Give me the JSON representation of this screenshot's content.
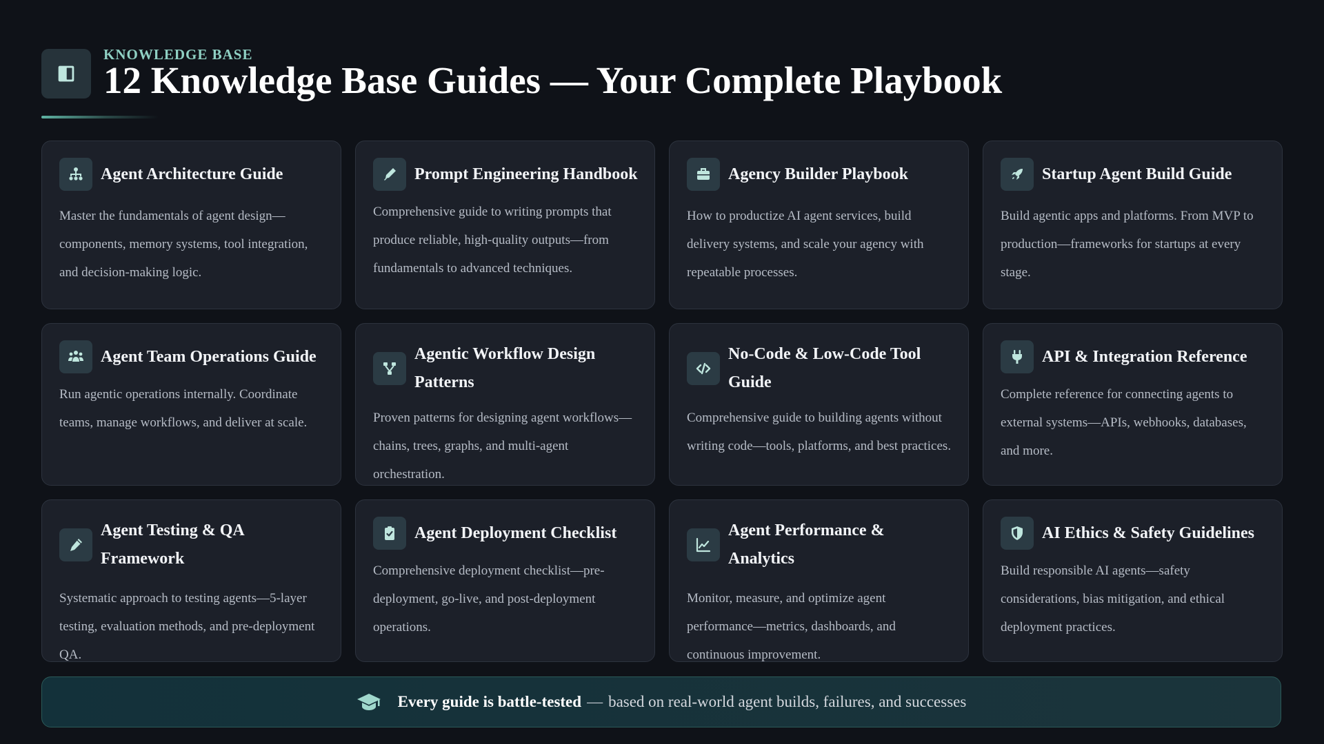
{
  "header": {
    "kicker": "KNOWLEDGE BASE",
    "title": "12 Knowledge Base Guides — Your Complete Playbook",
    "icon": "book-open-icon"
  },
  "cards": [
    {
      "icon": "hierarchy-icon",
      "title": "Agent Architecture Guide",
      "description": "Master the fundamentals of agent design—components, memory systems, tool integration, and decision-making logic."
    },
    {
      "icon": "pen-icon",
      "title": "Prompt Engineering Handbook",
      "description": "Comprehensive guide to writing prompts that produce reliable, high-quality outputs—from fundamentals to advanced techniques."
    },
    {
      "icon": "briefcase-icon",
      "title": "Agency Builder Playbook",
      "description": "How to productize AI agent services, build delivery systems, and scale your agency with repeatable processes."
    },
    {
      "icon": "rocket-icon",
      "title": "Startup Agent Build Guide",
      "description": "Build agentic apps and platforms. From MVP to production—frameworks for startups at every stage."
    },
    {
      "icon": "team-icon",
      "title": "Agent Team Operations Guide",
      "description": "Run agentic operations internally. Coordinate teams, manage workflows, and deliver at scale."
    },
    {
      "icon": "workflow-icon",
      "title": "Agentic Workflow Design Patterns",
      "description": "Proven patterns for designing agent workflows—chains, trees, graphs, and multi-agent orchestration."
    },
    {
      "icon": "code-icon",
      "title": "No-Code & Low-Code Tool Guide",
      "description": "Comprehensive guide to building agents without writing code—tools, platforms, and best practices."
    },
    {
      "icon": "plug-icon",
      "title": "API & Integration Reference",
      "description": "Complete reference for connecting agents to external systems—APIs, webhooks, databases, and more."
    },
    {
      "icon": "pencil-icon",
      "title": "Agent Testing & QA Framework",
      "description": "Systematic approach to testing agents—5-layer testing, evaluation methods, and pre-deployment QA."
    },
    {
      "icon": "clipboard-check-icon",
      "title": "Agent Deployment Checklist",
      "description": "Comprehensive deployment checklist—pre-deployment, go-live, and post-deployment operations."
    },
    {
      "icon": "chart-line-icon",
      "title": "Agent Performance & Analytics",
      "description": "Monitor, measure, and optimize agent performance—metrics, dashboards, and continuous improvement."
    },
    {
      "icon": "shield-icon",
      "title": "AI Ethics & Safety Guidelines",
      "description": "Build responsible AI agents—safety considerations, bias mitigation, and ethical deployment practices."
    }
  ],
  "footer": {
    "icon": "graduation-cap-icon",
    "strong": "Every guide is battle-tested",
    "separator": "—",
    "text": "based on real-world agent builds, failures, and successes"
  },
  "colors": {
    "background": "#0f1218",
    "card": "#1c2029",
    "accent": "#8fd0c3",
    "icon_tile": "#2b3b44"
  }
}
